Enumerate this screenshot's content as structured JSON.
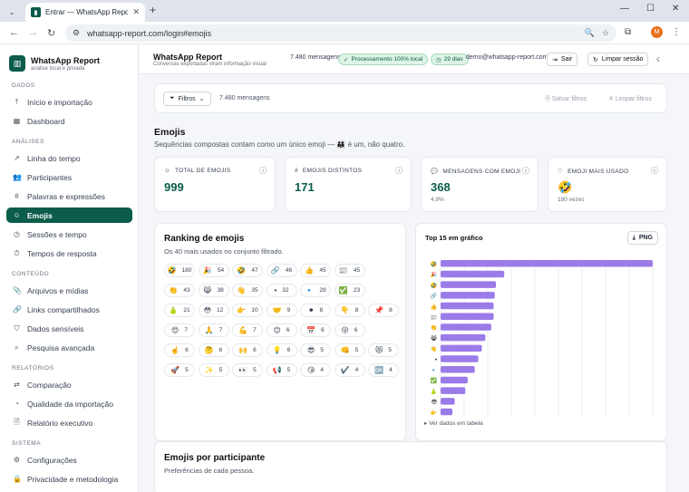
{
  "browser": {
    "tab_title": "Entrar — WhatsApp Report",
    "url": "whatsapp-report.com/login#emojis",
    "profile_initial": "M"
  },
  "sidebar": {
    "brand": {
      "name": "WhatsApp Report",
      "tagline": "análise local e privada"
    },
    "sections": [
      {
        "title": "DADOS",
        "items": [
          {
            "label": "Início e importação",
            "icon": "upload-icon"
          },
          {
            "label": "Dashboard",
            "icon": "dashboard-icon"
          }
        ]
      },
      {
        "title": "ANÁLISES",
        "items": [
          {
            "label": "Linha do tempo",
            "icon": "trend-icon"
          },
          {
            "label": "Participantes",
            "icon": "users-icon"
          },
          {
            "label": "Palavras e expressões",
            "icon": "hash-icon"
          },
          {
            "label": "Emojis",
            "icon": "smile-icon",
            "active": true
          },
          {
            "label": "Sessões e tempo",
            "icon": "clock-icon"
          },
          {
            "label": "Tempos de resposta",
            "icon": "timer-icon"
          }
        ]
      },
      {
        "title": "CONTEÚDO",
        "items": [
          {
            "label": "Arquivos e mídias",
            "icon": "paperclip-icon"
          },
          {
            "label": "Links compartilhados",
            "icon": "link-icon"
          },
          {
            "label": "Dados sensíveis",
            "icon": "shield-icon"
          },
          {
            "label": "Pesquisa avançada",
            "icon": "search-icon"
          }
        ]
      },
      {
        "title": "RELATÓRIOS",
        "items": [
          {
            "label": "Comparação",
            "icon": "compare-icon"
          },
          {
            "label": "Qualidade da importação",
            "icon": "quality-icon"
          },
          {
            "label": "Relatório executivo",
            "icon": "report-icon"
          }
        ]
      },
      {
        "title": "SISTEMA",
        "items": [
          {
            "label": "Configurações",
            "icon": "gear-icon"
          },
          {
            "label": "Privacidade e metodologia",
            "icon": "lock-icon"
          }
        ]
      }
    ]
  },
  "topbar": {
    "title": "WhatsApp Report",
    "subtitle": "Conversas exportadas viram informação visual",
    "messages": "7.480 mensagens",
    "processing": "Processamento 100% local",
    "days": "29 dias",
    "email": "demo@whatsapp-report.com",
    "logout": "Sair",
    "clear_session": "Limpar sessão"
  },
  "filters": {
    "button": "Filtros",
    "count": "7.480 mensagens",
    "save": "Salvar filtros",
    "clear": "Limpar filtros"
  },
  "page": {
    "title": "Emojis",
    "subtitle": "Sequências compostas contam como um único emoji — 👨‍👩‍👧 é um, não quatro."
  },
  "kpis": [
    {
      "label": "TOTAL DE EMOJIS",
      "value": "999",
      "sub": "",
      "icon": "smile-icon"
    },
    {
      "label": "EMOJIS DISTINTOS",
      "value": "171",
      "sub": "",
      "icon": "hash-icon"
    },
    {
      "label": "MENSAGENS COM EMOJI",
      "value": "368",
      "sub": "4,9%",
      "icon": "chat-icon"
    },
    {
      "label": "EMOJI MAIS USADO",
      "value": "🤣",
      "sub": "180 vezes",
      "icon": "heart-icon"
    }
  ],
  "ranking": {
    "title": "Ranking de emojis",
    "subtitle": "Os 40 mais usados no conjunto filtrado.",
    "items": [
      {
        "emoji": "🤣",
        "count": "180"
      },
      {
        "emoji": "🎉",
        "count": "54"
      },
      {
        "emoji": "🤣",
        "count": "47"
      },
      {
        "emoji": "🔗",
        "count": "46"
      },
      {
        "emoji": "👍",
        "count": "45"
      },
      {
        "emoji": "📰",
        "count": "45"
      },
      {
        "emoji": "👏",
        "count": "43"
      },
      {
        "emoji": "😹",
        "count": "38"
      },
      {
        "emoji": "👋",
        "count": "35"
      },
      {
        "emoji": "•",
        "count": "32"
      },
      {
        "emoji": "🔹",
        "count": "29"
      },
      {
        "emoji": "✅",
        "count": "23"
      },
      {
        "emoji": "🍐",
        "count": "21"
      },
      {
        "emoji": "😳",
        "count": "12"
      },
      {
        "emoji": "👉",
        "count": "10"
      },
      {
        "emoji": "🤝",
        "count": "9"
      },
      {
        "emoji": "⚫",
        "count": "8"
      },
      {
        "emoji": "👇",
        "count": "8"
      },
      {
        "emoji": "📌",
        "count": "8"
      },
      {
        "emoji": "😍",
        "count": "7"
      },
      {
        "emoji": "🙏",
        "count": "7"
      },
      {
        "emoji": "💪",
        "count": "7"
      },
      {
        "emoji": "😊",
        "count": "6"
      },
      {
        "emoji": "📅",
        "count": "6"
      },
      {
        "emoji": "😜",
        "count": "6"
      },
      {
        "emoji": "☝️",
        "count": "6"
      },
      {
        "emoji": "🤔",
        "count": "6"
      },
      {
        "emoji": "🙌",
        "count": "6"
      },
      {
        "emoji": "💡",
        "count": "6"
      },
      {
        "emoji": "😎",
        "count": "5"
      },
      {
        "emoji": "👊",
        "count": "5"
      },
      {
        "emoji": "😻",
        "count": "5"
      },
      {
        "emoji": "🚀",
        "count": "5"
      },
      {
        "emoji": "✨",
        "count": "5"
      },
      {
        "emoji": "👀",
        "count": "5"
      },
      {
        "emoji": "📢",
        "count": "5"
      },
      {
        "emoji": "😘",
        "count": "4"
      },
      {
        "emoji": "✔️",
        "count": "4"
      },
      {
        "emoji": "🆗",
        "count": "4"
      }
    ]
  },
  "bar_chart": {
    "title": "Top 15 em gráfico",
    "png_button": "PNG",
    "footer": "Ver dados em tabela"
  },
  "chart_data": {
    "type": "bar",
    "orientation": "horizontal",
    "title": "Top 15 em gráfico",
    "categories": [
      "🤣",
      "🎉",
      "🤣",
      "🔗",
      "👍",
      "📰",
      "👏",
      "😹",
      "👋",
      "•",
      "🔹",
      "✅",
      "🍐",
      "😳",
      "👉"
    ],
    "values": [
      180,
      54,
      47,
      46,
      45,
      45,
      43,
      38,
      35,
      32,
      29,
      23,
      21,
      12,
      10
    ],
    "xlim": [
      0,
      180
    ],
    "xticks": [
      0,
      20,
      40,
      60,
      80,
      100,
      120,
      140,
      160,
      180
    ],
    "grid": true,
    "bar_color": "#9b7be8"
  },
  "participants": {
    "title": "Emojis por participante",
    "subtitle": "Preferências de cada pessoa."
  },
  "colors": {
    "brand": "#0b5c4a",
    "bar": "#9b7be8"
  }
}
